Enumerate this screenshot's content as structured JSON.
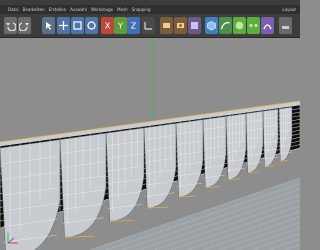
{
  "menu": {
    "items": [
      "Datei",
      "Bearbeiten",
      "Erstellen",
      "Auswahl",
      "Werkzeuge",
      "Mesh",
      "Snapping"
    ],
    "right_label": "Layout"
  },
  "toolbar": {
    "buttons": [
      {
        "name": "undo-icon",
        "color": "#6b6b6b"
      },
      {
        "name": "redo-icon",
        "color": "#6b6b6b"
      },
      {
        "name": "select-icon",
        "color": "#5a6f8a"
      },
      {
        "name": "move-icon",
        "color": "#4f74a8"
      },
      {
        "name": "scale-icon",
        "color": "#4f74a8"
      },
      {
        "name": "rotate-icon",
        "color": "#4f74a8"
      },
      {
        "name": "axis-x-icon",
        "color": "#b74a3a"
      },
      {
        "name": "axis-y-icon",
        "color": "#5e9b3c"
      },
      {
        "name": "axis-z-icon",
        "color": "#3f6fb5"
      },
      {
        "name": "coordinate-system-icon",
        "color": "#4a4a4a"
      },
      {
        "name": "render-view-icon",
        "color": "#7a5d3b"
      },
      {
        "name": "render-settings-icon",
        "color": "#7a5d3b"
      },
      {
        "name": "picture-viewer-icon",
        "color": "#6a5a8a"
      },
      {
        "name": "cube-icon",
        "color": "#3f7fc4"
      },
      {
        "name": "spline-pen-icon",
        "color": "#4a8f4a"
      },
      {
        "name": "subdivision-icon",
        "color": "#5cae3e"
      },
      {
        "name": "array-icon",
        "color": "#5cae3e"
      },
      {
        "name": "deformer-icon",
        "color": "#7e5fae"
      },
      {
        "name": "scene-icon",
        "color": "#6a6a6a"
      },
      {
        "name": "camera-icon",
        "color": "#6a6a6a"
      },
      {
        "name": "light-icon",
        "color": "#6a6a6a"
      }
    ]
  },
  "viewport": {
    "background": "#8d8d8d",
    "floor_color": "#9aa0a4",
    "surface_color": "#c8ccd0",
    "wire_color": "#f4f6f8",
    "dark_face_color": "#0d0d0d",
    "highlight_color": "#e0b040",
    "y_axis_color": "#44b844"
  }
}
